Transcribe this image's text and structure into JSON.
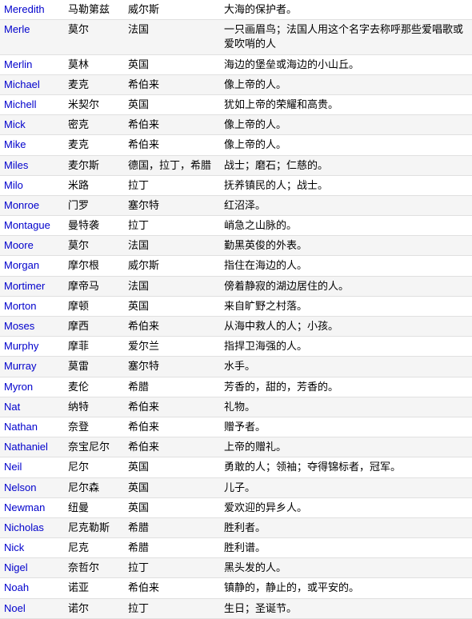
{
  "rows": [
    {
      "name": "Meredith",
      "chinese": "马勒第兹",
      "origin": "威尔斯",
      "meaning": "大海的保护者。"
    },
    {
      "name": "Merle",
      "chinese": "莫尔",
      "origin": "法国",
      "meaning": "一只画眉鸟；法国人用这个名字去称呼那些爱唱歌或爱吹哨的人"
    },
    {
      "name": "Merlin",
      "chinese": "莫林",
      "origin": "英国",
      "meaning": "海边的堡垒或海边的小山丘。"
    },
    {
      "name": "Michael",
      "chinese": "麦克",
      "origin": "希伯来",
      "meaning": "像上帝的人。"
    },
    {
      "name": "Michell",
      "chinese": "米契尔",
      "origin": "英国",
      "meaning": "犹如上帝的荣耀和高贵。"
    },
    {
      "name": "Mick",
      "chinese": "密克",
      "origin": "希伯来",
      "meaning": "像上帝的人。"
    },
    {
      "name": "Mike",
      "chinese": "麦克",
      "origin": "希伯来",
      "meaning": "像上帝的人。"
    },
    {
      "name": "Miles",
      "chinese": "麦尔斯",
      "origin": "德国，拉丁，希腊",
      "meaning": "战士；磨石；仁慈的。"
    },
    {
      "name": "Milo",
      "chinese": "米路",
      "origin": "拉丁",
      "meaning": "抚养镇民的人；战士。"
    },
    {
      "name": "Monroe",
      "chinese": "门罗",
      "origin": "塞尔特",
      "meaning": "红沼泽。"
    },
    {
      "name": "Montague",
      "chinese": "曼特袭",
      "origin": "拉丁",
      "meaning": "峭急之山脉的。"
    },
    {
      "name": "Moore",
      "chinese": "莫尔",
      "origin": "法国",
      "meaning": "勤黑英俊的外表。"
    },
    {
      "name": "Morgan",
      "chinese": "摩尔根",
      "origin": "威尔斯",
      "meaning": "指住在海边的人。"
    },
    {
      "name": "Mortimer",
      "chinese": "摩帝马",
      "origin": "法国",
      "meaning": "傍着静寂的湖边居住的人。"
    },
    {
      "name": "Morton",
      "chinese": "摩顿",
      "origin": "英国",
      "meaning": "来自旷野之村落。"
    },
    {
      "name": "Moses",
      "chinese": "摩西",
      "origin": "希伯来",
      "meaning": "从海中救人的人；小孩。"
    },
    {
      "name": "Murphy",
      "chinese": "摩菲",
      "origin": "爱尔兰",
      "meaning": "指捍卫海强的人。"
    },
    {
      "name": "Murray",
      "chinese": "莫雷",
      "origin": "塞尔特",
      "meaning": "水手。"
    },
    {
      "name": "Myron",
      "chinese": "麦伦",
      "origin": "希腊",
      "meaning": "芳香的，甜的，芳香的。"
    },
    {
      "name": "Nat",
      "chinese": "纳特",
      "origin": "希伯来",
      "meaning": "礼物。"
    },
    {
      "name": "Nathan",
      "chinese": "奈登",
      "origin": "希伯来",
      "meaning": "赠予者。"
    },
    {
      "name": "Nathaniel",
      "chinese": "奈宝尼尔",
      "origin": "希伯来",
      "meaning": "上帝的赠礼。"
    },
    {
      "name": "Neil",
      "chinese": "尼尔",
      "origin": "英国",
      "meaning": "勇敢的人；领袖；夺得锦标者，冠军。"
    },
    {
      "name": "Nelson",
      "chinese": "尼尔森",
      "origin": "英国",
      "meaning": "儿子。"
    },
    {
      "name": "Newman",
      "chinese": "纽曼",
      "origin": "英国",
      "meaning": "爱欢迎的异乡人。"
    },
    {
      "name": "Nicholas",
      "chinese": "尼克勒斯",
      "origin": "希腊",
      "meaning": "胜利者。"
    },
    {
      "name": "Nick",
      "chinese": "尼克",
      "origin": "希腊",
      "meaning": "胜利谱。"
    },
    {
      "name": "Nigel",
      "chinese": "奈哲尔",
      "origin": "拉丁",
      "meaning": "黑头发的人。"
    },
    {
      "name": "Noah",
      "chinese": "诺亚",
      "origin": "希伯来",
      "meaning": "镇静的，静止的，或平安的。"
    },
    {
      "name": "Noel",
      "chinese": "诺尔",
      "origin": "拉丁",
      "meaning": "生日；圣诞节。"
    }
  ]
}
